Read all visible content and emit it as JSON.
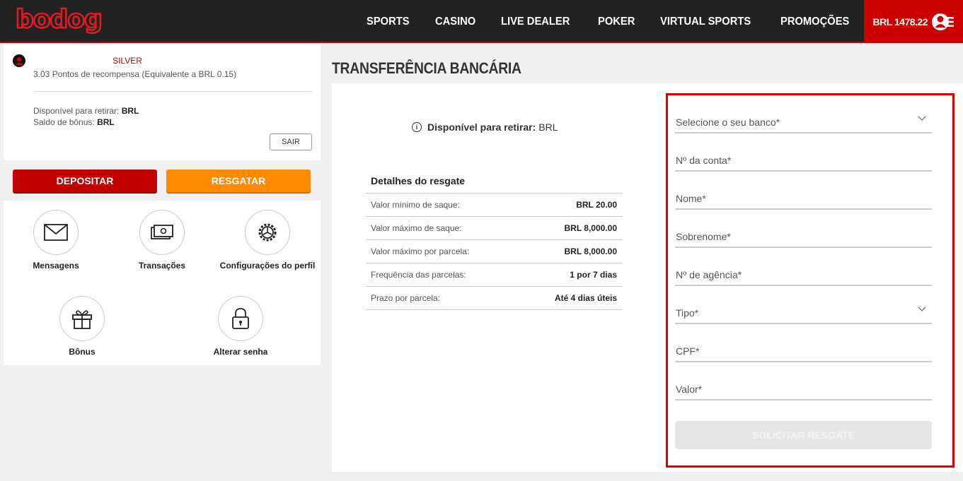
{
  "header": {
    "logo": "bodog",
    "nav": [
      "SPORTS",
      "CASINO",
      "LIVE DEALER",
      "POKER",
      "VIRTUAL SPORTS",
      "PROMOÇÕES"
    ],
    "balance": "BRL 1478.22"
  },
  "sidebar": {
    "tier": "SILVER",
    "points": "3.03 Pontos de recompensa (Equivalente a BRL 0.15)",
    "available_label": "Disponível para retirar:",
    "available_value": "BRL",
    "bonus_label": "Saldo de bônus:",
    "bonus_value": "BRL",
    "logout": "SAIR",
    "deposit": "DEPOSITAR",
    "withdraw": "RESGATAR",
    "menu": {
      "messages": "Mensagens",
      "transactions": "Transações",
      "profile_settings": "Configurações do perfil",
      "bonus": "Bônus",
      "change_password": "Alterar senha"
    }
  },
  "main": {
    "title": "TRANSFERÊNCIA BANCÁRIA",
    "available_label": "Disponível para retirar:",
    "available_value": "BRL",
    "details_title": "Detalhes do resgate",
    "details": [
      {
        "label": "Valor mínimo de saque:",
        "value": "BRL 20.00"
      },
      {
        "label": "Valor máximo de saque:",
        "value": "BRL 8,000.00"
      },
      {
        "label": "Valor máximo por parcela:",
        "value": "BRL 8,000.00"
      },
      {
        "label": "Frequência das parcelas:",
        "value": "1 por 7 dias"
      },
      {
        "label": "Prazo por parcela:",
        "value": "Até 4 dias úteis"
      }
    ],
    "form": {
      "bank": "Selecione o seu banco*",
      "account": "Nº da conta*",
      "name": "Nome*",
      "surname": "Sobrenome*",
      "agency": "Nº de agência*",
      "type": "Tipo*",
      "cpf": "CPF*",
      "amount": "Valor*",
      "submit": "SOLICITAR RESGATE"
    }
  },
  "colors": {
    "brand_red": "#cc0000",
    "orange": "#ff8a00",
    "highlight_border": "#e00000"
  }
}
